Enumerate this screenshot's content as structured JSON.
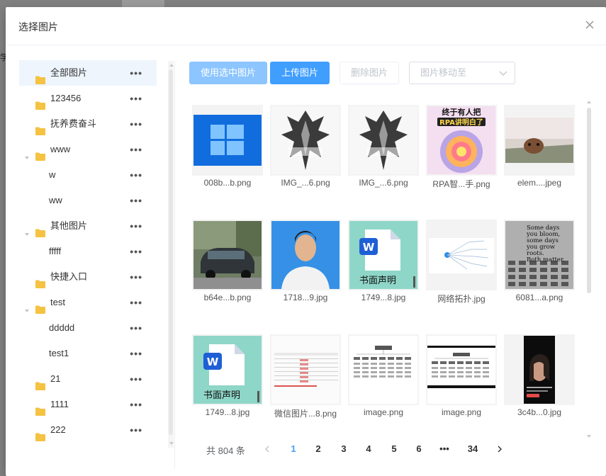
{
  "backdrop": {
    "side_char": "学"
  },
  "dialog": {
    "title": "选择图片",
    "close_icon": "close-icon"
  },
  "tree": {
    "items": [
      {
        "label": "全部图片",
        "folder": true,
        "expanded": null,
        "level": 0,
        "active": true
      },
      {
        "label": "123456",
        "folder": true,
        "expanded": null,
        "level": 0,
        "active": false
      },
      {
        "label": "抚养费奋斗",
        "folder": true,
        "expanded": null,
        "level": 0,
        "active": false
      },
      {
        "label": "www",
        "folder": true,
        "expanded": true,
        "level": 0,
        "active": false
      },
      {
        "label": "w",
        "folder": false,
        "expanded": null,
        "level": 1,
        "active": false
      },
      {
        "label": "ww",
        "folder": false,
        "expanded": null,
        "level": 1,
        "active": false
      },
      {
        "label": "其他图片",
        "folder": true,
        "expanded": true,
        "level": 0,
        "active": false
      },
      {
        "label": "fffff",
        "folder": false,
        "expanded": null,
        "level": 1,
        "active": false
      },
      {
        "label": "快捷入口",
        "folder": true,
        "expanded": null,
        "level": 0,
        "active": false
      },
      {
        "label": "test",
        "folder": true,
        "expanded": true,
        "level": 0,
        "active": false
      },
      {
        "label": "ddddd",
        "folder": false,
        "expanded": null,
        "level": 1,
        "active": false
      },
      {
        "label": "test1",
        "folder": false,
        "expanded": null,
        "level": 1,
        "active": false
      },
      {
        "label": "21",
        "folder": true,
        "expanded": null,
        "level": 0,
        "active": false
      },
      {
        "label": "1111",
        "folder": true,
        "expanded": null,
        "level": 0,
        "active": false
      },
      {
        "label": "222",
        "folder": true,
        "expanded": null,
        "level": 0,
        "active": false
      }
    ],
    "more_label": "•••"
  },
  "toolbar": {
    "use_selected": "使用选中图片",
    "upload": "上传图片",
    "delete": "删除图片",
    "move_placeholder": "图片移动至"
  },
  "images": [
    {
      "name": "008b...b.png",
      "thumb": "windows"
    },
    {
      "name": "IMG_...6.png",
      "thumb": "armor"
    },
    {
      "name": "IMG_...6.png",
      "thumb": "armor"
    },
    {
      "name": "RPA智...手.png",
      "thumb": "rpa",
      "thumb_text": [
        "终于有人把",
        "RPA讲明白了"
      ]
    },
    {
      "name": "elem....jpeg",
      "thumb": "deer"
    },
    {
      "name": "b64e...b.png",
      "thumb": "car"
    },
    {
      "name": "1718...9.jpg",
      "thumb": "person"
    },
    {
      "name": "1749...8.jpg",
      "thumb": "word",
      "thumb_text": [
        "书面声明"
      ]
    },
    {
      "name": "网络拓扑.jpg",
      "thumb": "network"
    },
    {
      "name": "6081...a.png",
      "thumb": "building",
      "thumb_text": [
        "Some days",
        "you bloom,",
        "some days",
        "you grow",
        "roots.",
        "Both matter."
      ]
    },
    {
      "name": "1749...8.jpg",
      "thumb": "word",
      "thumb_text": [
        "书面声明"
      ]
    },
    {
      "name": "微信图片...8.png",
      "thumb": "table"
    },
    {
      "name": "image.png",
      "thumb": "orgchart"
    },
    {
      "name": "image.png",
      "thumb": "orgchart-dark"
    },
    {
      "name": "3c4b...0.jpg",
      "thumb": "phone"
    }
  ],
  "pagination": {
    "total_text": "共 804 条",
    "pages": [
      "1",
      "2",
      "3",
      "4",
      "5",
      "6",
      "•••",
      "34"
    ],
    "current": "1"
  },
  "colors": {
    "primary": "#409eff",
    "primary_light": "#8cc5ff",
    "folder": "#f5c242",
    "active_row": "#eef5fd"
  }
}
